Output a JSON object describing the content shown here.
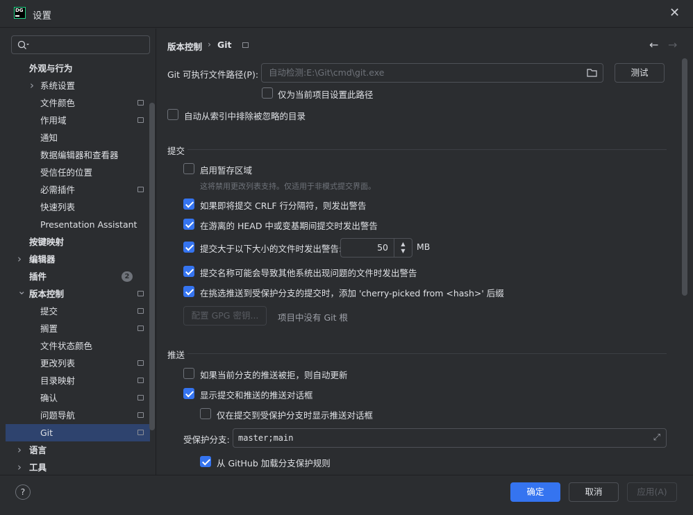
{
  "window": {
    "title": "设置",
    "logo_text": "DG"
  },
  "search": {
    "placeholder": ""
  },
  "tree": [
    {
      "label": "外观与行为",
      "level": 0,
      "bold": true
    },
    {
      "label": "系统设置",
      "level": 1,
      "chevron": true
    },
    {
      "label": "文件颜色",
      "level": 1,
      "project": true
    },
    {
      "label": "作用域",
      "level": 1,
      "project": true
    },
    {
      "label": "通知",
      "level": 1
    },
    {
      "label": "数据编辑器和查看器",
      "level": 1
    },
    {
      "label": "受信任的位置",
      "level": 1
    },
    {
      "label": "必需插件",
      "level": 1,
      "project": true
    },
    {
      "label": "快速列表",
      "level": 1
    },
    {
      "label": "Presentation Assistant",
      "level": 1
    },
    {
      "label": "按键映射",
      "level": 0,
      "bold": true
    },
    {
      "label": "编辑器",
      "level": 0,
      "bold": true,
      "chevron": true
    },
    {
      "label": "插件",
      "level": 0,
      "bold": true,
      "badge": "2"
    },
    {
      "label": "版本控制",
      "level": 0,
      "bold": true,
      "chevron": true,
      "expanded": true,
      "project": true
    },
    {
      "label": "提交",
      "level": 1,
      "project": true
    },
    {
      "label": "搁置",
      "level": 1,
      "project": true
    },
    {
      "label": "文件状态颜色",
      "level": 1
    },
    {
      "label": "更改列表",
      "level": 1,
      "project": true
    },
    {
      "label": "目录映射",
      "level": 1,
      "project": true
    },
    {
      "label": "确认",
      "level": 1,
      "project": true
    },
    {
      "label": "问题导航",
      "level": 1,
      "project": true
    },
    {
      "label": "Git",
      "level": 1,
      "project": true,
      "selected": true
    },
    {
      "label": "语言",
      "level": 0,
      "bold": true,
      "chevron": true
    },
    {
      "label": "工具",
      "level": 0,
      "bold": true,
      "chevron": true
    }
  ],
  "breadcrumb": {
    "parent": "版本控制",
    "sep": "›",
    "current": "Git"
  },
  "git_path": {
    "label": "Git 可执行文件路径(P):",
    "placeholder": "自动检测:E:\\Git\\cmd\\git.exe",
    "test_button": "测试",
    "project_only": {
      "label": "仅为当前项目设置此路径",
      "checked": false
    }
  },
  "exclude_ignored": {
    "label": "自动从索引中排除被忽略的目录",
    "checked": false
  },
  "commit_section": {
    "title": "提交",
    "staging": {
      "label": "启用暂存区域",
      "checked": false,
      "hint": "这将禁用更改列表支持。仅适用于非模式提交界面。"
    },
    "crlf": {
      "label": "如果即将提交 CRLF 行分隔符，则发出警告",
      "checked": true
    },
    "detached": {
      "label": "在游离的 HEAD 中或变基期间提交时发出警告",
      "checked": true
    },
    "large_file": {
      "label": "提交大于以下大小的文件时发出警告:",
      "checked": true,
      "value": "50",
      "unit": "MB"
    },
    "bad_names": {
      "label": "提交名称可能会导致其他系统出现问题的文件时发出警告",
      "checked": true
    },
    "cherry": {
      "label": "在挑选推送到受保护分支的提交时，添加 'cherry-picked from <hash>' 后缀",
      "checked": true
    },
    "gpg_button": "配置 GPG 密钥...",
    "gpg_hint": "项目中没有 Git 根"
  },
  "push_section": {
    "title": "推送",
    "auto_update": {
      "label": "如果当前分支的推送被拒，则自动更新",
      "checked": false
    },
    "show_dialog": {
      "label": "显示提交和推送的推送对话框",
      "checked": true
    },
    "protected_only": {
      "label": "仅在提交到受保护分支时显示推送对话框",
      "checked": false
    },
    "protected_branches": {
      "label": "受保护分支:",
      "value": "master;main"
    },
    "github_rules": {
      "label": "从 GitHub 加载分支保护规则",
      "checked": true
    }
  },
  "footer": {
    "ok": "确定",
    "cancel": "取消",
    "apply": "应用(A)"
  },
  "colors": {
    "accent": "#3574f0",
    "selection": "#2e436e",
    "background": "#2b2d30"
  }
}
